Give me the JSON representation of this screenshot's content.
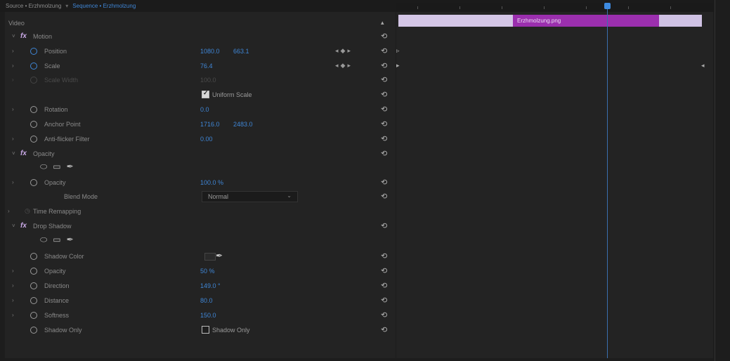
{
  "breadcrumb": {
    "source": "Source • Erzhmolzung",
    "sequence": "Sequence • Erzhmolzung"
  },
  "panel": {
    "header": "Video",
    "motion": {
      "label": "Motion",
      "position": {
        "label": "Position",
        "x": "1080.0",
        "y": "663.1"
      },
      "scale": {
        "label": "Scale",
        "value": "76.4"
      },
      "scale_width": {
        "label": "Scale Width",
        "value": "100.0"
      },
      "uniform_scale": {
        "label": "Uniform Scale",
        "checked": true
      },
      "rotation": {
        "label": "Rotation",
        "value": "0.0"
      },
      "anchor_point": {
        "label": "Anchor Point",
        "x": "1716.0",
        "y": "2483.0"
      },
      "anti_flicker": {
        "label": "Anti-flicker Filter",
        "value": "0.00"
      }
    },
    "opacity": {
      "label": "Opacity",
      "opacity": {
        "label": "Opacity",
        "value": "100.0 %"
      },
      "blend_mode": {
        "label": "Blend Mode",
        "value": "Normal"
      }
    },
    "time_remapping": {
      "label": "Time Remapping"
    },
    "drop_shadow": {
      "label": "Drop Shadow",
      "shadow_color": {
        "label": "Shadow Color"
      },
      "opacity": {
        "label": "Opacity",
        "value": "50 %"
      },
      "direction": {
        "label": "Direction",
        "value": "149.0 °"
      },
      "distance": {
        "label": "Distance",
        "value": "80.0"
      },
      "softness": {
        "label": "Softness",
        "value": "150.0"
      },
      "shadow_only": {
        "label": "Shadow Only",
        "checkbox_label": "Shadow Only",
        "checked": false
      }
    }
  },
  "timeline": {
    "clip_label": "Erzhmolzung.png"
  },
  "colors": {
    "accent_blue": "#3f86d6",
    "clip_purple": "#9b2fae",
    "clip_lilac": "#d4c6e6"
  }
}
